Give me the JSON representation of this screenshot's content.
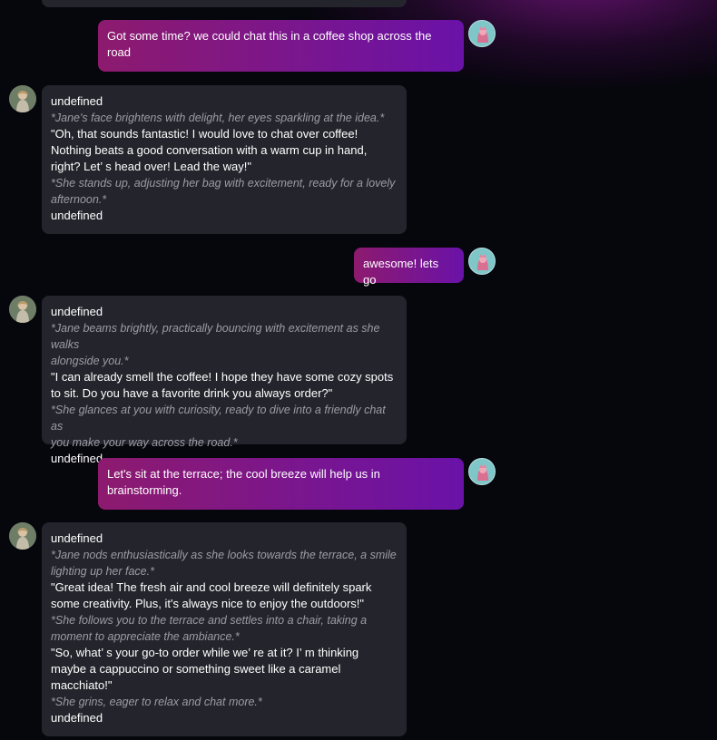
{
  "colors": {
    "background": "#06060d",
    "bot_bubble": "#24252c",
    "user_bubble_start": "#8d1a6e",
    "user_bubble_end": "#6a12a8",
    "action_text": "#9b9ca6",
    "user_avatar": "#7fc6c9"
  },
  "messages": [
    {
      "role": "user",
      "avatar": "user-avatar",
      "lines": [
        "Got some time? we could chat this in a coffee shop across the",
        "road"
      ]
    },
    {
      "role": "bot",
      "avatar": "character-avatar",
      "header": "undefined",
      "action_1": [
        "*Jane's face brightens with delight, her eyes sparkling at the idea.*"
      ],
      "speech_1": [
        " \"Oh, that sounds fantastic! I would love to chat over coffee!",
        "Nothing beats a good conversation with a warm cup in hand,",
        "right? Let’ s head over! Lead the way!\""
      ],
      "action_2": [
        "*She stands up, adjusting her bag with excitement, ready for a lovely",
        "afternoon.*"
      ],
      "footer": "undefined"
    },
    {
      "role": "user",
      "avatar": "user-avatar",
      "lines": [
        "awesome! lets go"
      ]
    },
    {
      "role": "bot",
      "avatar": "character-avatar",
      "header": "undefined",
      "action_1": [
        "*Jane beams brightly, practically bouncing with excitement as she walks",
        "alongside you.*"
      ],
      "speech_1": [
        " \"I can already smell the coffee! I hope they have some cozy spots",
        "to sit. Do you have a favorite drink you always order?\""
      ],
      "action_2": [
        "*She glances at you with curiosity, ready to dive into a friendly chat as",
        "you make your way across the road.*"
      ],
      "footer": "undefined"
    },
    {
      "role": "user",
      "avatar": "user-avatar",
      "lines": [
        "Let's sit at the terrace; the cool breeze will help us in",
        "brainstorming."
      ]
    },
    {
      "role": "bot",
      "avatar": "character-avatar",
      "header": "undefined",
      "action_1": [
        "*Jane nods enthusiastically as she looks towards the terrace, a smile",
        "lighting up her face.*"
      ],
      "speech_1": [
        " \"Great idea! The fresh air and cool breeze will definitely spark",
        "some creativity. Plus, it's always nice to enjoy the outdoors!\""
      ],
      "action_2": [
        "*She follows you to the terrace and settles into a chair, taking a",
        "moment to appreciate the ambiance.*"
      ],
      "speech_2": [
        " \"So, what’ s your go-to order while we’ re at it? I’ m thinking",
        "maybe a cappuccino or something sweet like a caramel",
        "macchiato!\""
      ],
      "action_3": [
        "*She grins, eager to relax and chat more.*"
      ],
      "footer": "undefined"
    }
  ]
}
